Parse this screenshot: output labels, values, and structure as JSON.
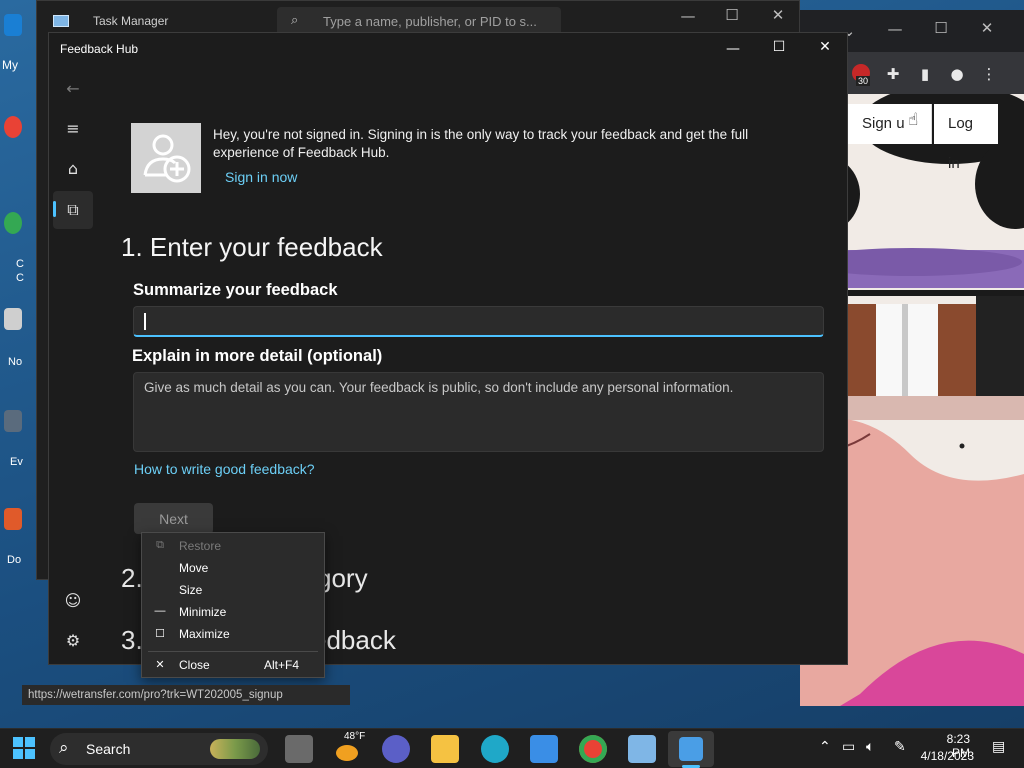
{
  "desktop": {
    "icons": [
      {
        "label": "My"
      },
      {
        "label": "C"
      },
      {
        "label": "C"
      },
      {
        "label": "No"
      },
      {
        "label": "Ev"
      },
      {
        "label": "Do"
      }
    ]
  },
  "task_manager": {
    "title": "Task Manager",
    "search_placeholder": "Type a name, publisher, or PID to s..."
  },
  "browser": {
    "extension_badge": "30",
    "sign_in_label": "Sign u",
    "login_label": "Log in"
  },
  "feedback_hub": {
    "title": "Feedback Hub",
    "signin_message": "Hey, you're not signed in. Signing in is the only way to track your feedback and get the full experience of Feedback Hub.",
    "signin_link": "Sign in now",
    "step1_title": "1. Enter your feedback",
    "summary_label": "Summarize your feedback",
    "summary_value": "",
    "detail_label": "Explain in more detail (optional)",
    "detail_placeholder": "Give as much detail as you can. Your feedback is public, so don't include any personal information.",
    "howto_link": "How to write good feedback?",
    "next_label": "Next",
    "step2_prefix": "2.",
    "step2_suffix": "gory",
    "step3_prefix": "3.",
    "step3_suffix": "edback"
  },
  "context_menu": {
    "items": [
      {
        "label": "Restore",
        "shortcut": "",
        "icon": "restore-icon"
      },
      {
        "label": "Move",
        "shortcut": "",
        "icon": ""
      },
      {
        "label": "Size",
        "shortcut": "",
        "icon": ""
      },
      {
        "label": "Minimize",
        "shortcut": "",
        "icon": "minimize-icon"
      },
      {
        "label": "Maximize",
        "shortcut": "",
        "icon": "maximize-icon"
      },
      {
        "label": "Close",
        "shortcut": "Alt+F4",
        "icon": "close-icon"
      }
    ]
  },
  "status_bar": {
    "url": "https://wetransfer.com/pro?trk=WT202005_signup"
  },
  "taskbar": {
    "search_label": "Search",
    "weather_temp": "48°F",
    "time": "8:23 PM",
    "date": "4/18/2023"
  },
  "colors": {
    "accent": "#4cc2ff",
    "link": "#6ccff6",
    "window_bg": "#1c1c1c"
  }
}
